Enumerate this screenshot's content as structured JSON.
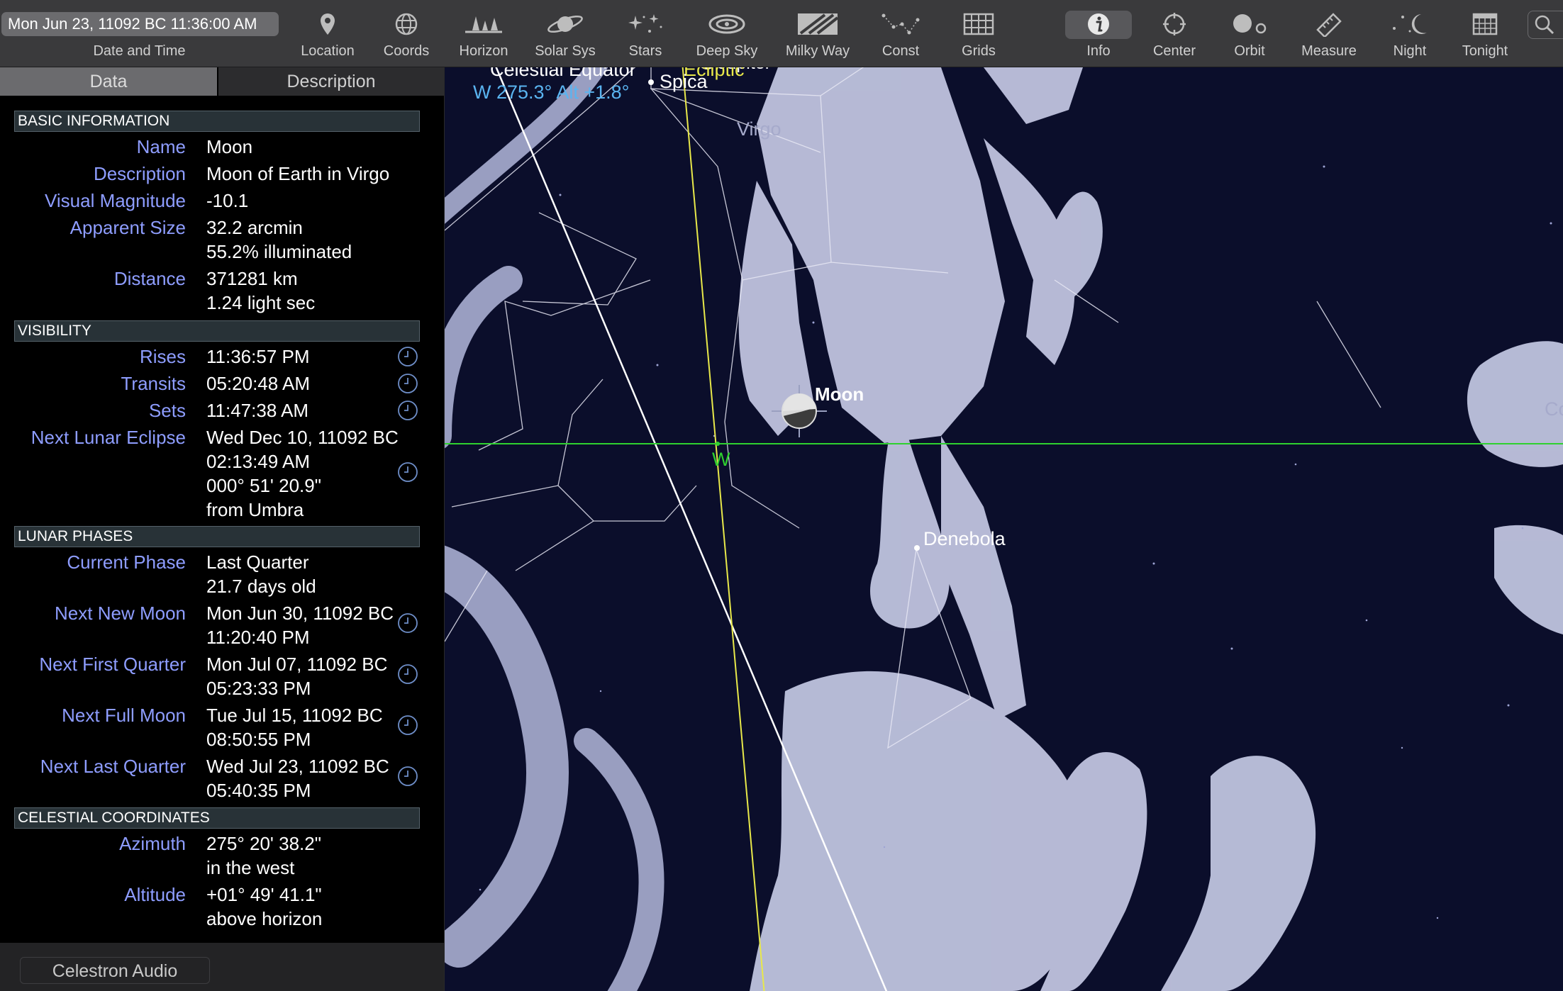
{
  "toolbar": {
    "date_time_value": "Mon Jun 23, 11092 BC 11:36:00 AM",
    "date_time_label": "Date and Time",
    "buttons": {
      "location": "Location",
      "coords": "Coords",
      "horizon": "Horizon",
      "solar_sys": "Solar Sys",
      "stars": "Stars",
      "deep_sky": "Deep Sky",
      "milky_way": "Milky Way",
      "const": "Const",
      "grids": "Grids",
      "info": "Info",
      "center": "Center",
      "orbit": "Orbit",
      "measure": "Measure",
      "night": "Night",
      "tonight": "Tonight"
    },
    "icons": {
      "location": "map-pin-icon",
      "coords": "globe-icon",
      "horizon": "horizon-trees-icon",
      "solar_sys": "saturn-icon",
      "stars": "stars-icon",
      "deep_sky": "galaxy-icon",
      "milky_way": "milky-way-icon",
      "const": "constellation-icon",
      "grids": "grid-icon",
      "info": "info-icon",
      "center": "crosshair-icon",
      "orbit": "orbit-icon",
      "measure": "ruler-icon",
      "night": "moon-icon",
      "tonight": "calendar-icon",
      "search": "search-icon"
    }
  },
  "sidebar": {
    "tabs": {
      "data": "Data",
      "description": "Description"
    },
    "sections": {
      "basic": "BASIC INFORMATION",
      "visibility": "VISIBILITY",
      "phases": "LUNAR PHASES",
      "coords": "CELESTIAL COORDINATES"
    },
    "basic": {
      "name_label": "Name",
      "name_value": "Moon",
      "description_label": "Description",
      "description_value": "Moon of Earth in Virgo",
      "magnitude_label": "Visual Magnitude",
      "magnitude_value": "-10.1",
      "size_label": "Apparent Size",
      "size_value_1": "32.2 arcmin",
      "size_value_2": "55.2% illuminated",
      "distance_label": "Distance",
      "distance_value_1": "371281 km",
      "distance_value_2": "1.24 light sec"
    },
    "visibility": {
      "rises_label": "Rises",
      "rises_value": "11:36:57 PM",
      "transits_label": "Transits",
      "transits_value": "05:20:48 AM",
      "sets_label": "Sets",
      "sets_value": "11:47:38 AM",
      "eclipse_label": "Next Lunar Eclipse",
      "eclipse_value_1": "Wed Dec 10, 11092 BC",
      "eclipse_value_2": "02:13:49 AM",
      "eclipse_value_3": "000° 51' 20.9\"",
      "eclipse_value_4": "from Umbra"
    },
    "phases": {
      "current_label": "Current Phase",
      "current_value_1": "Last Quarter",
      "current_value_2": "21.7 days old",
      "new_label": "Next New Moon",
      "new_value_1": "Mon Jun 30, 11092 BC",
      "new_value_2": "11:20:40 PM",
      "first_label": "Next First Quarter",
      "first_value_1": "Mon Jul 07, 11092 BC",
      "first_value_2": "05:23:33 PM",
      "full_label": "Next Full Moon",
      "full_value_1": "Tue Jul 15, 11092 BC",
      "full_value_2": "08:50:55 PM",
      "last_label": "Next Last Quarter",
      "last_value_1": "Wed Jul 23, 11092 BC",
      "last_value_2": "05:40:35 PM"
    },
    "coords": {
      "azimuth_label": "Azimuth",
      "azimuth_value_1": "275° 20' 38.2\"",
      "azimuth_value_2": "in the west",
      "altitude_label": "Altitude",
      "altitude_value_1": "+01° 49' 41.1\"",
      "altitude_value_2": "above horizon"
    },
    "footer_button": "Celestron Audio"
  },
  "sky": {
    "view_readout": "W 275.3° Alt +1.8°",
    "labels": {
      "celestial_equator": "Celestial Equator",
      "ecliptic": "Ecliptic",
      "jupiter": "Jupiter",
      "spica": "Spica",
      "virgo": "Virgo",
      "moon": "Moon",
      "west": "W",
      "denebola": "Denebola",
      "edge_label": "Co"
    },
    "colors": {
      "readout": "#5ab4f0",
      "ecliptic": "#e8e84a",
      "horizon": "#2fd12f",
      "constellation_art": "#c7cbe6",
      "background": "#0b0e2b"
    }
  }
}
